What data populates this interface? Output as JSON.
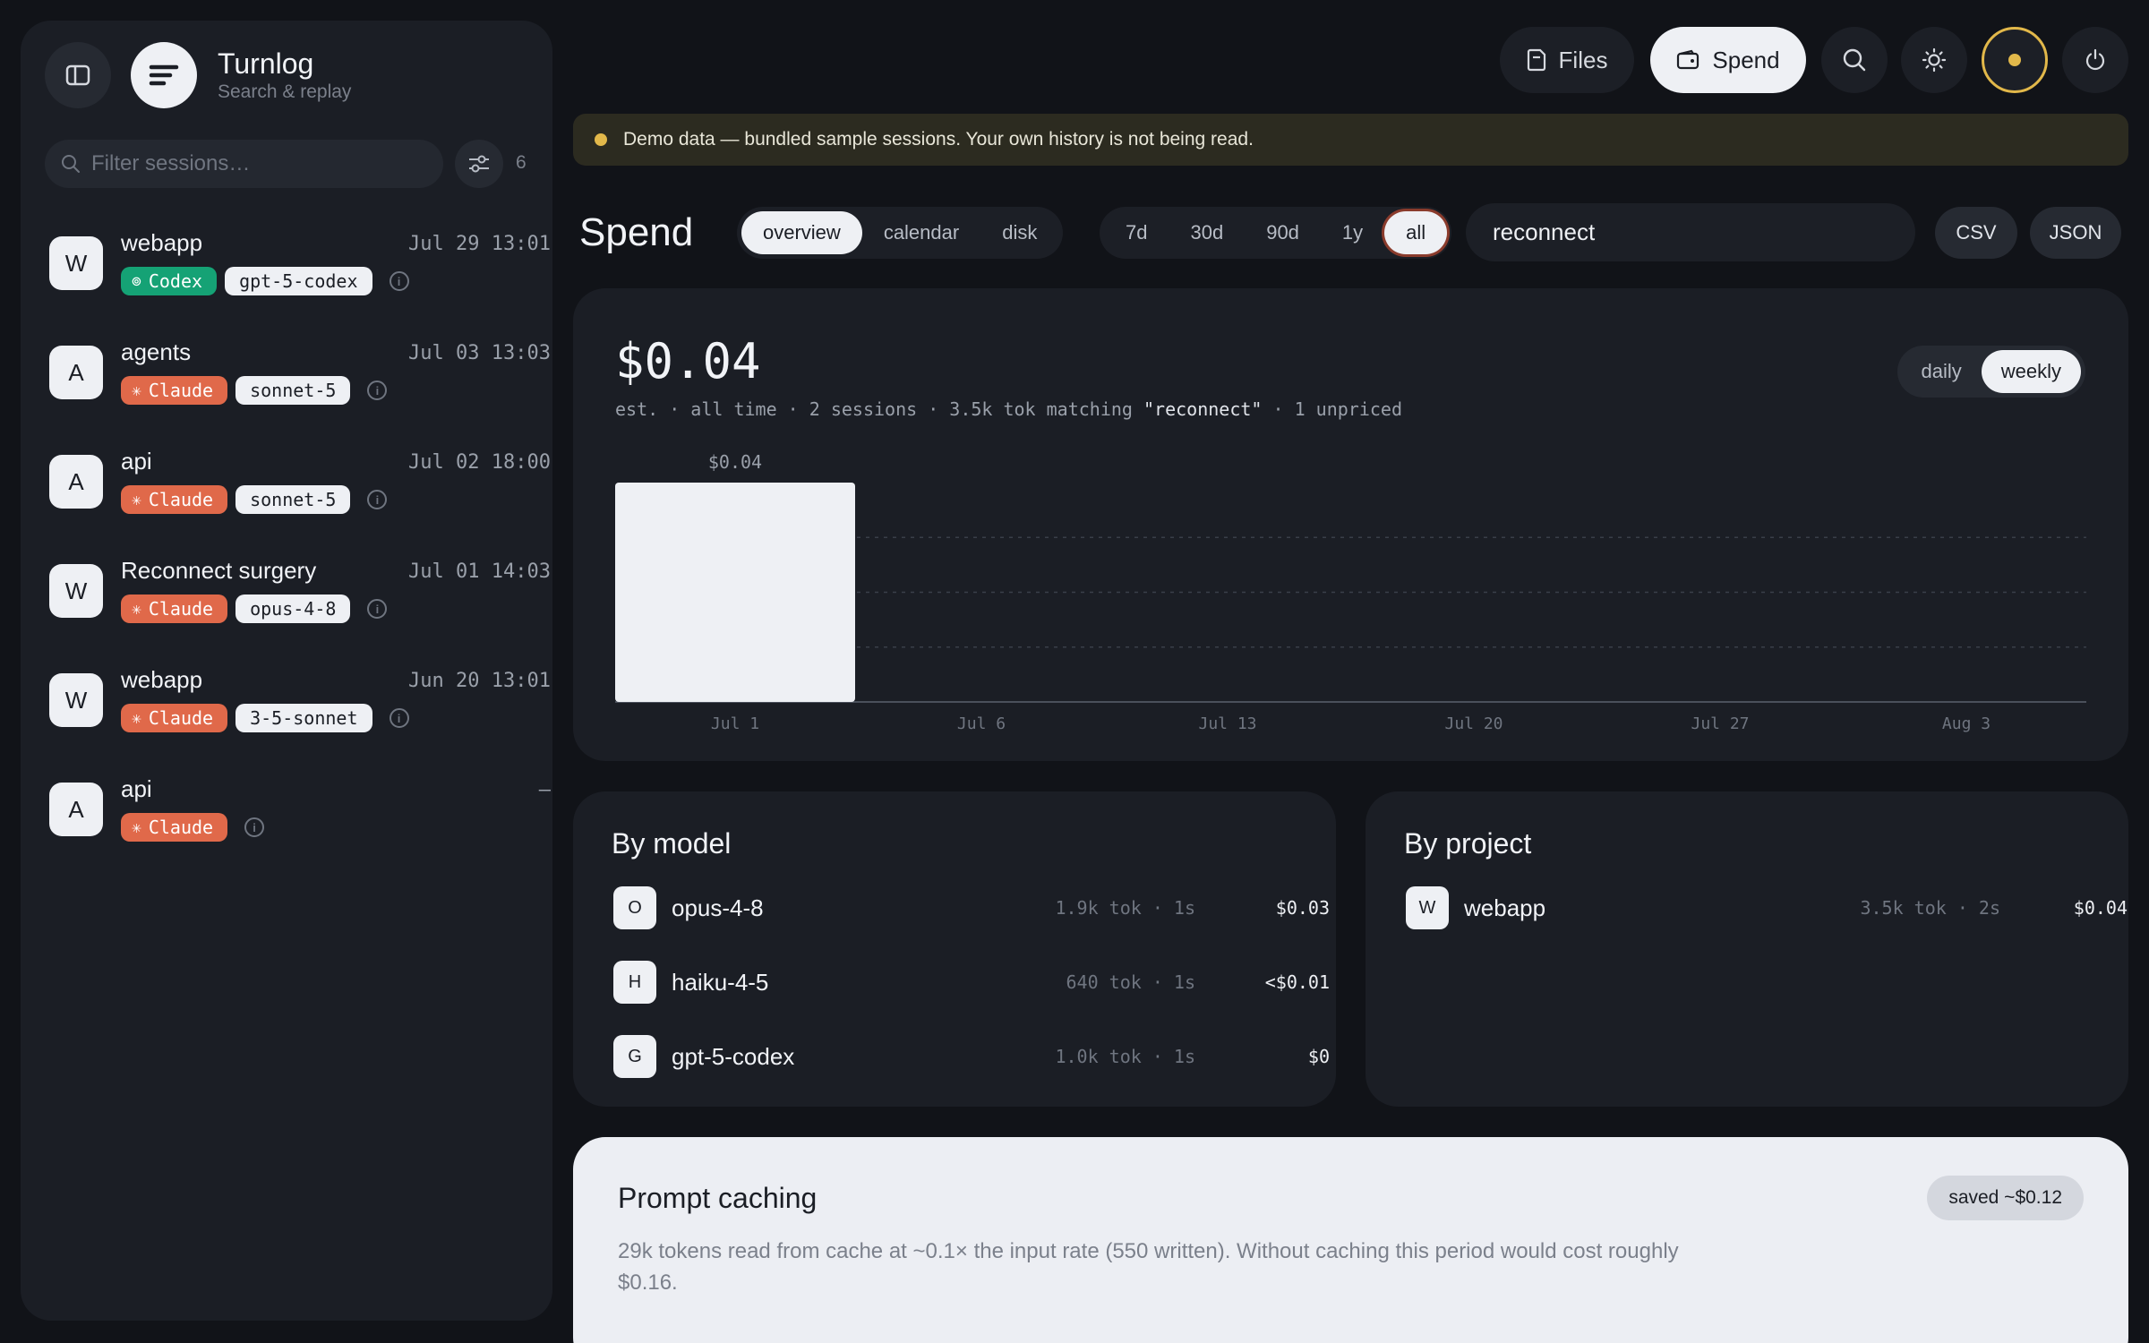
{
  "sidebar": {
    "app_title": "Turnlog",
    "app_subtitle": "Search & replay",
    "filter_placeholder": "Filter sessions…",
    "session_count": "6",
    "sessions": [
      {
        "avatar": "W",
        "name": "webapp",
        "time": "Jul 29 13:01",
        "agent": "Codex",
        "model": "gpt-5-codex"
      },
      {
        "avatar": "A",
        "name": "agents",
        "time": "Jul 03 13:03",
        "agent": "Claude",
        "model": "sonnet-5"
      },
      {
        "avatar": "A",
        "name": "api",
        "time": "Jul 02 18:00",
        "agent": "Claude",
        "model": "sonnet-5"
      },
      {
        "avatar": "W",
        "name": "Reconnect surgery",
        "time": "Jul 01 14:03",
        "agent": "Claude",
        "model": "opus-4-8"
      },
      {
        "avatar": "W",
        "name": "webapp",
        "time": "Jun 20 13:01",
        "agent": "Claude",
        "model": "3-5-sonnet"
      },
      {
        "avatar": "A",
        "name": "api",
        "time": "–",
        "agent": "Claude",
        "model": ""
      }
    ]
  },
  "topnav": {
    "files_label": "Files",
    "spend_label": "Spend"
  },
  "banner": {
    "text": "Demo data — bundled sample sessions. Your own history is not being read."
  },
  "spend": {
    "title": "Spend",
    "views": [
      "overview",
      "calendar",
      "disk"
    ],
    "active_view": "overview",
    "ranges": [
      "7d",
      "30d",
      "90d",
      "1y",
      "all"
    ],
    "active_range": "all",
    "query": "reconnect",
    "export_csv": "CSV",
    "export_json": "JSON"
  },
  "summary": {
    "amount": "$0.04",
    "subline_prefix": "est. · all time · 2 sessions · 3.5k tok matching ",
    "subline_query": "\"reconnect\"",
    "subline_suffix": " · 1 unpriced",
    "granularity": [
      "daily",
      "weekly"
    ],
    "active_granularity": "weekly"
  },
  "chart_data": {
    "type": "bar",
    "categories": [
      "Jul 1",
      "Jul 6",
      "Jul 13",
      "Jul 20",
      "Jul 27",
      "Aug 3"
    ],
    "values": [
      0.04,
      0,
      0,
      0,
      0,
      0
    ],
    "value_labels": [
      "$0.04",
      "",
      "",
      "",
      "",
      ""
    ],
    "ylim": [
      0,
      0.04
    ],
    "grid": true
  },
  "by_model": {
    "title": "By model",
    "rows": [
      {
        "avatar": "O",
        "name": "opus-4-8",
        "stats": "1.9k tok · 1s",
        "cost": "$0.03"
      },
      {
        "avatar": "H",
        "name": "haiku-4-5",
        "stats": "640 tok · 1s",
        "cost": "<$0.01"
      },
      {
        "avatar": "G",
        "name": "gpt-5-codex",
        "stats": "1.0k tok · 1s",
        "cost": "$0"
      }
    ]
  },
  "by_project": {
    "title": "By project",
    "rows": [
      {
        "avatar": "W",
        "name": "webapp",
        "stats": "3.5k tok · 2s",
        "cost": "$0.04"
      }
    ]
  },
  "caching": {
    "title": "Prompt caching",
    "saved": "saved ~$0.12",
    "description": "29k tokens read from cache at ~0.1× the input rate (550 written). Without caching this period would cost roughly $0.16."
  },
  "colors": {
    "claude": "#e0694a",
    "codex": "#15a275",
    "warning": "#e2b84a",
    "bar": "#eef0f4"
  }
}
